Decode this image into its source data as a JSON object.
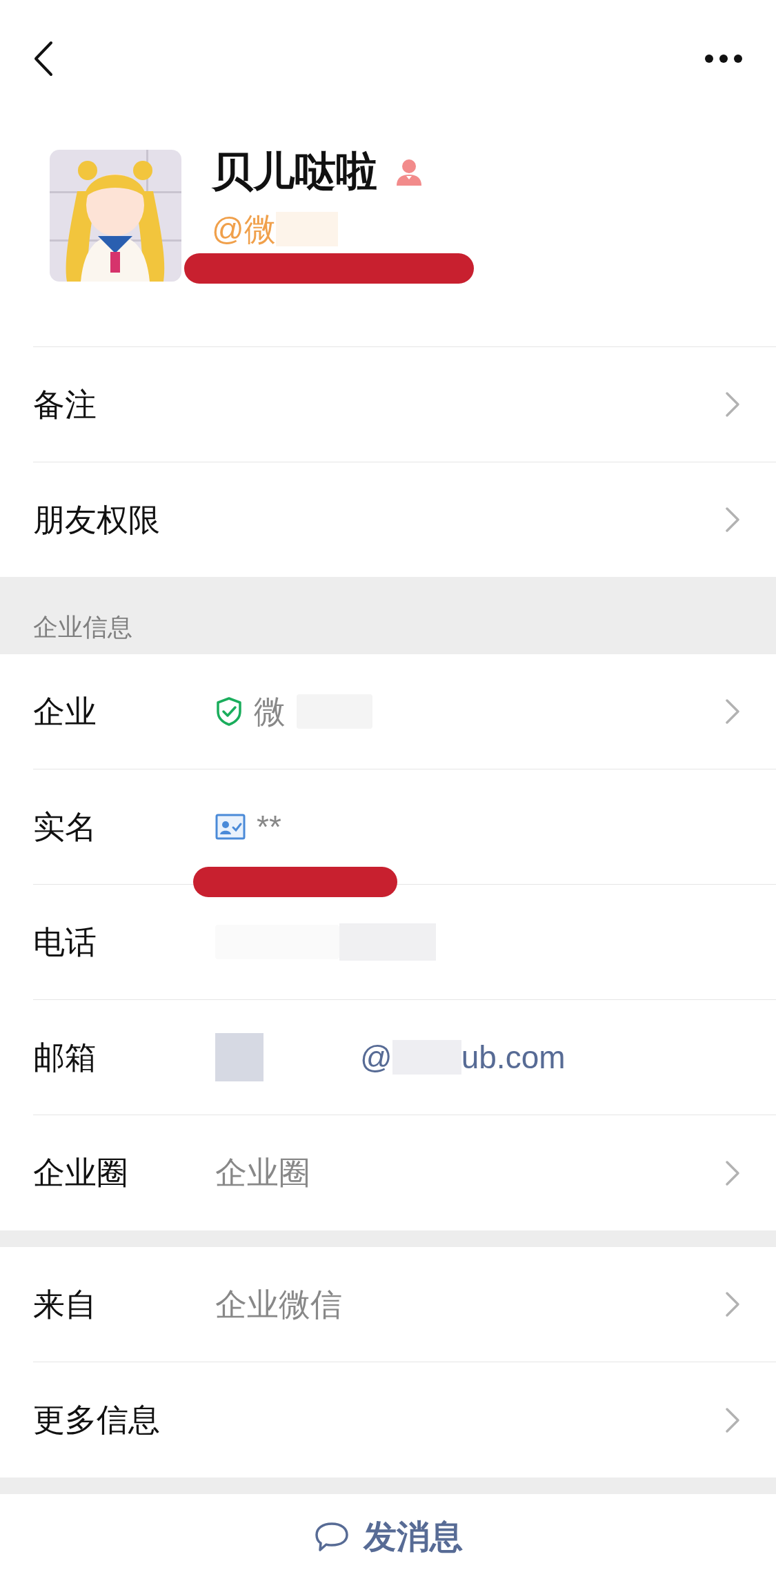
{
  "profile": {
    "name": "贝儿哒啦",
    "handle": "@微"
  },
  "top_rows": [
    {
      "label": "备注",
      "arrow": true
    },
    {
      "label": "朋友权限",
      "arrow": true
    }
  ],
  "section_title": "企业信息",
  "company_rows": [
    {
      "kind": "company",
      "label": "企业",
      "value": "微",
      "arrow": true
    },
    {
      "kind": "realname",
      "label": "实名",
      "value": "**",
      "arrow": false
    },
    {
      "kind": "phone",
      "label": "电话",
      "arrow": false
    },
    {
      "kind": "email",
      "label": "邮箱",
      "value": "@",
      "suffix": "ub.com",
      "arrow": false
    },
    {
      "kind": "text",
      "label": "企业圈",
      "value": "企业圈",
      "arrow": true
    }
  ],
  "bottom_rows": [
    {
      "kind": "text",
      "label": "来自",
      "value": "企业微信",
      "arrow": true
    },
    {
      "kind": "plain",
      "label": "更多信息",
      "arrow": true
    }
  ],
  "send_button": "发消息"
}
